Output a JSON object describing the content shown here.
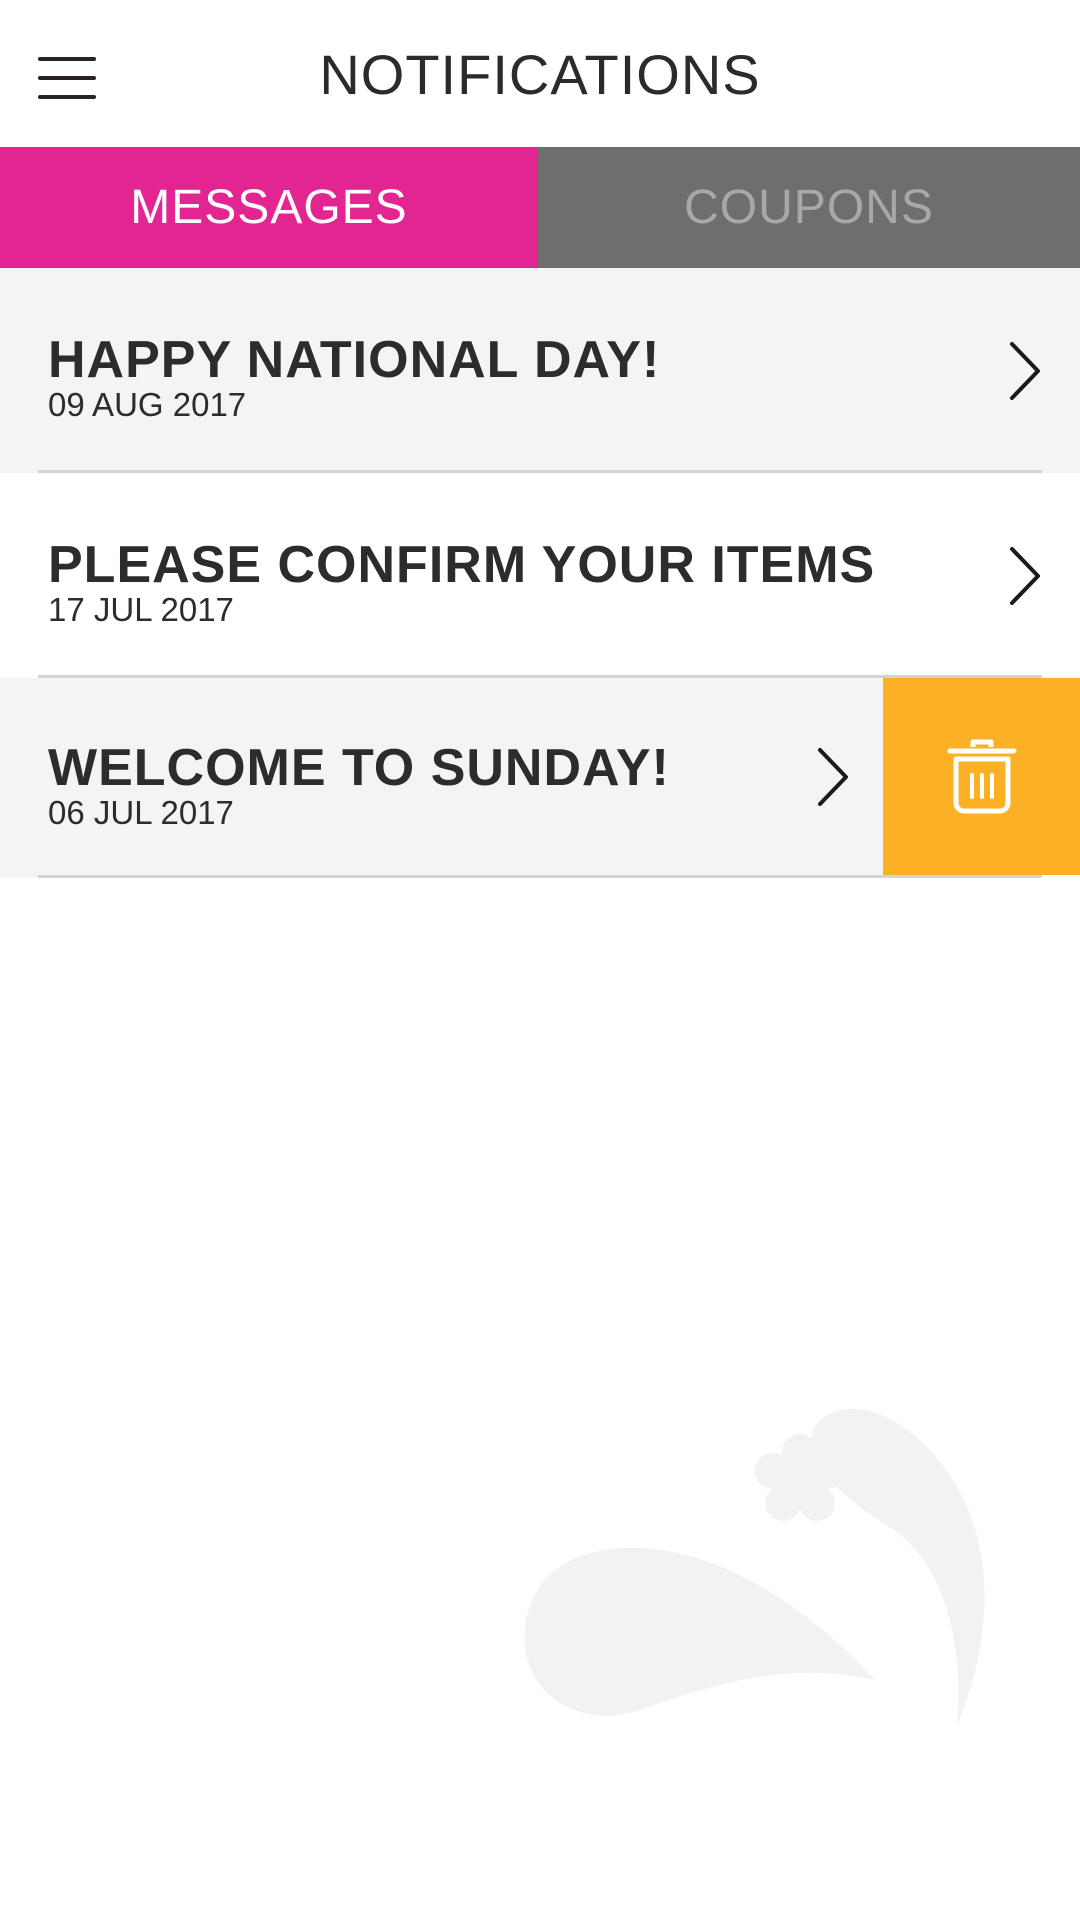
{
  "header": {
    "title": "NOTIFICATIONS",
    "menu_icon": "hamburger-menu-icon"
  },
  "tabs": [
    {
      "label": "MESSAGES",
      "active": true,
      "color": "#e32592"
    },
    {
      "label": "COUPONS",
      "active": false,
      "color": "#6e6e6e"
    }
  ],
  "messages": [
    {
      "title": "HAPPY NATIONAL DAY!",
      "date": "09 AUG 2017"
    },
    {
      "title": "PLEASE CONFIRM YOUR ITEMS",
      "date": "17 JUL 2017"
    },
    {
      "title": "WELCOME TO SUNDAY!",
      "date": "06 JUL 2017"
    }
  ],
  "actions": {
    "delete_icon": "trash-icon",
    "delete_color": "#fbb123"
  }
}
